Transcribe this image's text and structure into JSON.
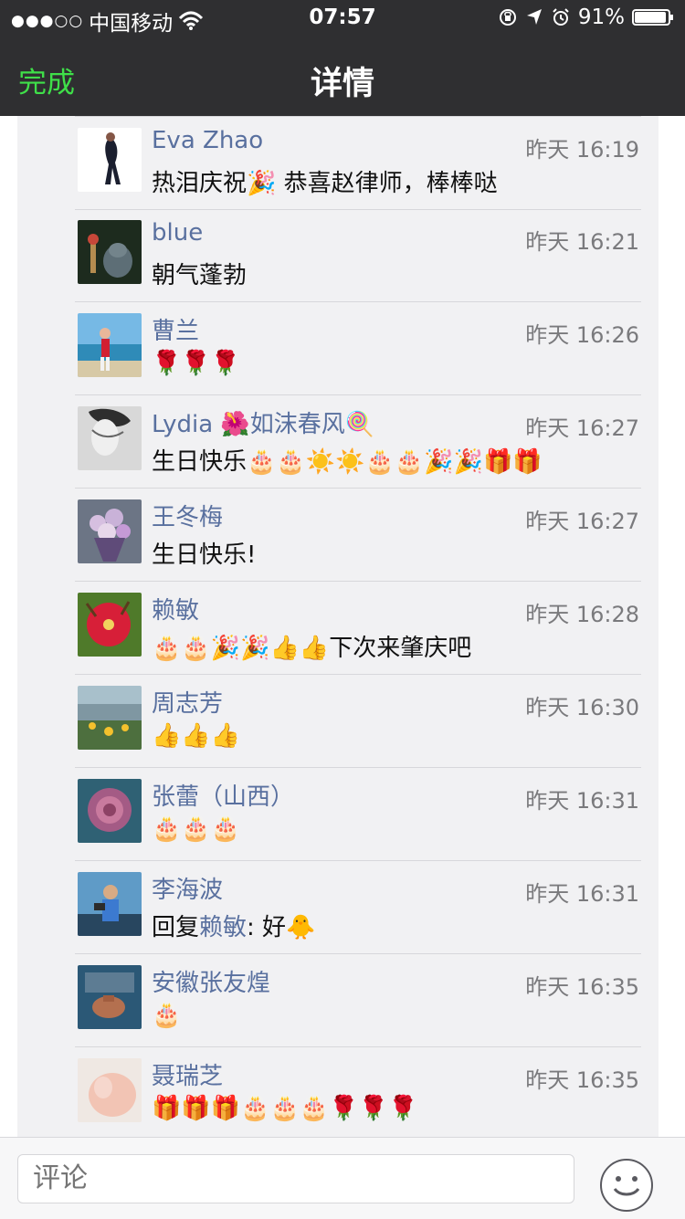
{
  "status_bar": {
    "signal": "●●●○○",
    "carrier": "中国移动",
    "time": "07:57",
    "battery_percent": "91%"
  },
  "nav": {
    "done_label": "完成",
    "title": "详情"
  },
  "comments": [
    {
      "name": "Eva Zhao",
      "time": "昨天 16:19",
      "message": "热泪庆祝🎉 恭喜赵律师，棒棒哒"
    },
    {
      "name": "blue",
      "time": "昨天 16:21",
      "message": "朝气蓬勃"
    },
    {
      "name": "曹兰",
      "time": "昨天 16:26",
      "message": "🌹🌹🌹"
    },
    {
      "name": "Lydia 🌺如沫春风🍭",
      "time": "昨天 16:27",
      "message": "生日快乐🎂🎂☀️☀️🎂🎂🎉🎉🎁🎁"
    },
    {
      "name": "王冬梅",
      "time": "昨天 16:27",
      "message": "生日快乐!"
    },
    {
      "name": "赖敏",
      "time": "昨天 16:28",
      "message": "🎂🎂🎉🎉👍👍下次来肇庆吧"
    },
    {
      "name": "周志芳",
      "time": "昨天 16:30",
      "message": "👍👍👍"
    },
    {
      "name": "张蕾（山西）",
      "time": "昨天 16:31",
      "message": "🎂🎂🎂"
    },
    {
      "name": "李海波",
      "time": "昨天 16:31",
      "reply_prefix": "回复",
      "reply_to": "赖敏",
      "message": ": 好🐥"
    },
    {
      "name": "安徽张友煌",
      "time": "昨天 16:35",
      "message": "🎂"
    },
    {
      "name": "聂瑞芝",
      "time": "昨天 16:35",
      "message": "🎁🎁🎁🎂🎂🎂🌹🌹🌹"
    }
  ],
  "footer": {
    "comment_placeholder": "评论"
  }
}
